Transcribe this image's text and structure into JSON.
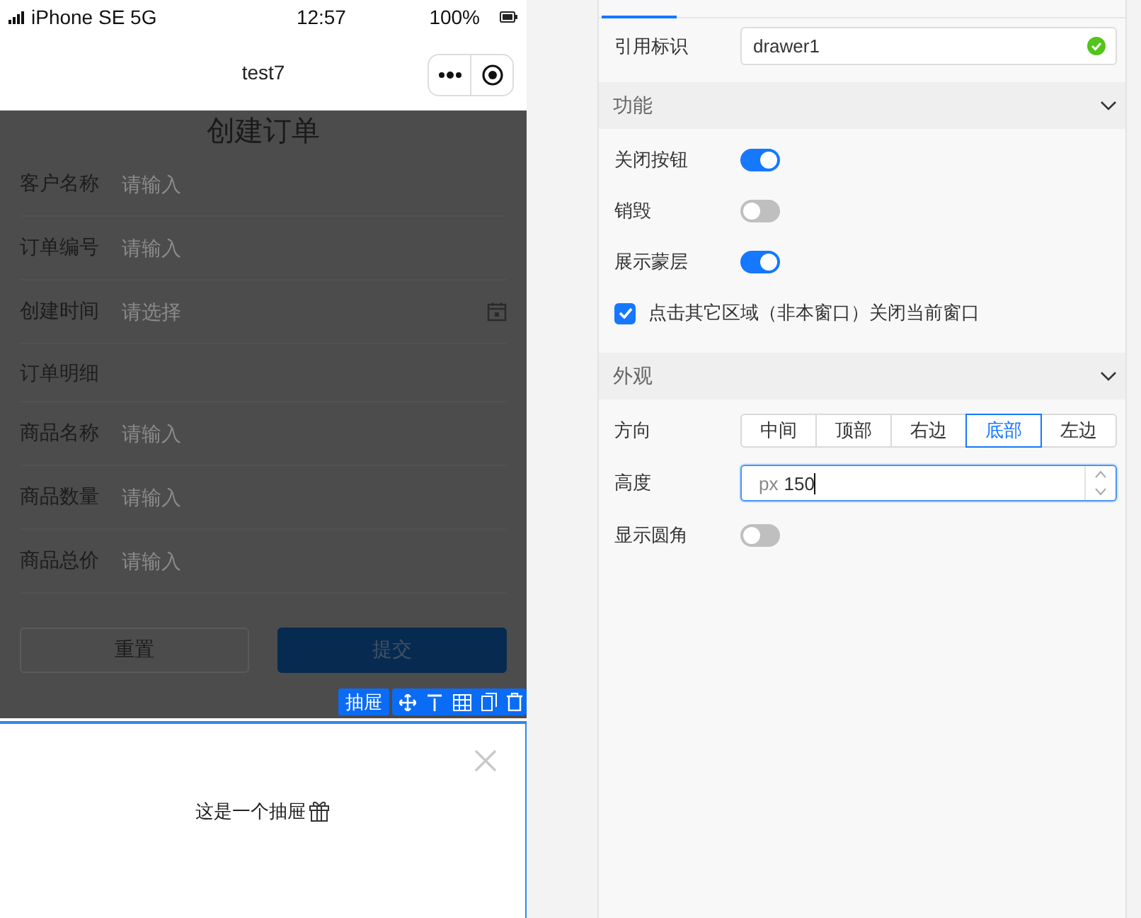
{
  "status_bar": {
    "carrier": "iPhone SE 5G",
    "time": "12:57",
    "battery": "100%"
  },
  "nav_bar": {
    "title": "test7"
  },
  "form": {
    "title": "创建订单",
    "fields": [
      {
        "label": "客户名称",
        "placeholder": "请输入",
        "kind": "input"
      },
      {
        "label": "订单编号",
        "placeholder": "请输入",
        "kind": "input"
      },
      {
        "label": "创建时间",
        "placeholder": "请选择",
        "kind": "date"
      }
    ],
    "section": "订单明细",
    "items": [
      {
        "label": "商品名称",
        "placeholder": "请输入"
      },
      {
        "label": "商品数量",
        "placeholder": "请输入"
      },
      {
        "label": "商品总价",
        "placeholder": "请输入"
      }
    ],
    "buttons": [
      {
        "label": "重置",
        "kind": "secondary"
      },
      {
        "label": "提交",
        "kind": "primary"
      }
    ]
  },
  "selection_toolbar": {
    "label": "抽屉"
  },
  "drawer": {
    "text": "这是一个抽屉"
  },
  "panel": {
    "reference": {
      "label": "引用标识",
      "value": "drawer1",
      "valid": true
    },
    "sections": [
      {
        "title": "功能",
        "expanded": true,
        "rows": [
          {
            "kind": "switch",
            "label": "关闭按钮",
            "on": true
          },
          {
            "kind": "switch",
            "label": "销毁",
            "on": false
          },
          {
            "kind": "switch",
            "label": "展示蒙层",
            "on": true
          },
          {
            "kind": "checkbox",
            "label": "点击其它区域（非本窗口）关闭当前窗口",
            "checked": true
          }
        ]
      },
      {
        "title": "外观",
        "expanded": true,
        "rows": [
          {
            "kind": "segmented",
            "label": "方向",
            "options": [
              {
                "label": "中间",
                "selected": false
              },
              {
                "label": "顶部",
                "selected": false
              },
              {
                "label": "右边",
                "selected": false
              },
              {
                "label": "底部",
                "selected": true
              },
              {
                "label": "左边",
                "selected": false
              }
            ]
          },
          {
            "kind": "number",
            "label": "高度",
            "unit": "px",
            "value": "150"
          },
          {
            "kind": "switch",
            "label": "显示圆角",
            "on": false
          }
        ]
      }
    ]
  }
}
